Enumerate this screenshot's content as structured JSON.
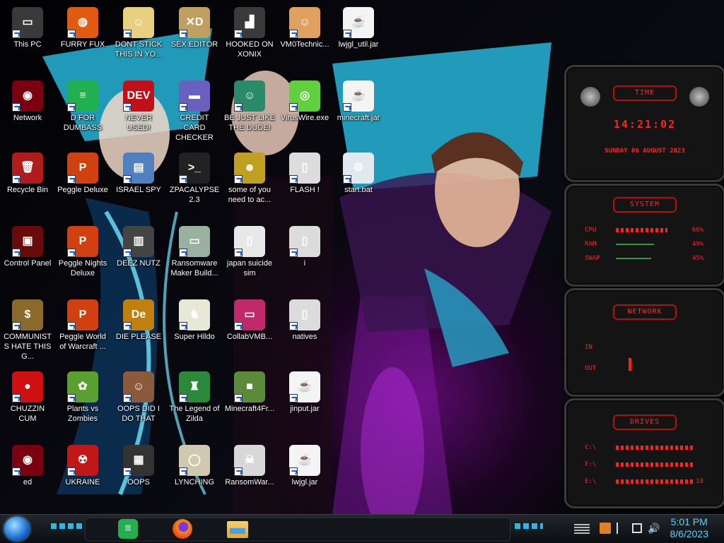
{
  "desktop": {
    "icons": [
      {
        "id": "this-pc",
        "label": "This PC",
        "col": 0,
        "row": 0,
        "color": "#3a3a3a",
        "glyph": "▭"
      },
      {
        "id": "network",
        "label": "Network",
        "col": 0,
        "row": 1,
        "color": "#7a0010",
        "glyph": "◉"
      },
      {
        "id": "recycle-bin",
        "label": "Recycle Bin",
        "col": 0,
        "row": 2,
        "color": "#b01c1c",
        "glyph": "🗑"
      },
      {
        "id": "control-panel",
        "label": "Control Panel",
        "col": 0,
        "row": 3,
        "color": "#6a0a0a",
        "glyph": "▣"
      },
      {
        "id": "communists",
        "label": "COMMUNISTS HATE THIS G...",
        "col": 0,
        "row": 4,
        "color": "#8a6a2a",
        "glyph": "$"
      },
      {
        "id": "chuzzin-cum",
        "label": "CHUZZIN CUM",
        "col": 0,
        "row": 5,
        "color": "#d01010",
        "glyph": "●"
      },
      {
        "id": "bottom-left",
        "label": "ed",
        "col": 0,
        "row": 6,
        "color": "#7a0010",
        "glyph": "◉"
      },
      {
        "id": "furry-fux",
        "label": "FURRY FUX",
        "col": 1,
        "row": 0,
        "color": "#e25a10",
        "glyph": "◍"
      },
      {
        "id": "d-for-dumbass",
        "label": "D FOR DUMBASS",
        "col": 1,
        "row": 1,
        "color": "#20b050",
        "glyph": "≡"
      },
      {
        "id": "peggle-deluxe",
        "label": "Peggle Deluxe",
        "col": 1,
        "row": 2,
        "color": "#d04010",
        "glyph": "P"
      },
      {
        "id": "peggle-nights",
        "label": "Peggle Nights Deluxe",
        "col": 1,
        "row": 3,
        "color": "#d04010",
        "glyph": "P"
      },
      {
        "id": "peggle-world",
        "label": "Peggle World of Warcraft ...",
        "col": 1,
        "row": 4,
        "color": "#d04010",
        "glyph": "P"
      },
      {
        "id": "plants-zombies",
        "label": "Plants vs Zombies",
        "col": 1,
        "row": 5,
        "color": "#5aa030",
        "glyph": "✿"
      },
      {
        "id": "ukraine",
        "label": "UKRAINE",
        "col": 1,
        "row": 6,
        "color": "#c01818",
        "glyph": "☢"
      },
      {
        "id": "dont-stick",
        "label": "DONT STICK THIS IN YO...",
        "col": 2,
        "row": 0,
        "color": "#e8d080",
        "glyph": "☺"
      },
      {
        "id": "never-used",
        "label": "NEVER USED!",
        "col": 2,
        "row": 1,
        "color": "#c0101a",
        "glyph": "DEV"
      },
      {
        "id": "israel-spy",
        "label": "ISRAEL SPY",
        "col": 2,
        "row": 2,
        "color": "#5080c0",
        "glyph": "▤"
      },
      {
        "id": "deez-nutz",
        "label": "DEEZ NUTZ",
        "col": 2,
        "row": 3,
        "color": "#444444",
        "glyph": "▥"
      },
      {
        "id": "die-please",
        "label": "DIE PLEASE",
        "col": 2,
        "row": 4,
        "color": "#c08010",
        "glyph": "De"
      },
      {
        "id": "oops-did-i",
        "label": "OOPS DID I DO THAT",
        "col": 2,
        "row": 5,
        "color": "#8a5a3a",
        "glyph": "☺"
      },
      {
        "id": "oops",
        "label": "OOPS",
        "col": 2,
        "row": 6,
        "color": "#333333",
        "glyph": "▦"
      },
      {
        "id": "sex-editor",
        "label": "SEX EDITOR",
        "col": 3,
        "row": 0,
        "color": "#c0a060",
        "glyph": "✕D"
      },
      {
        "id": "credit-card",
        "label": "CREDIT CARD CHECKER",
        "col": 3,
        "row": 1,
        "color": "#6a60c0",
        "glyph": "▬"
      },
      {
        "id": "zpacalypse",
        "label": "ZPACALYPSE 2.3",
        "col": 3,
        "row": 2,
        "color": "#222222",
        "glyph": ">_"
      },
      {
        "id": "ransomware-maker",
        "label": "Ransomware Maker Build...",
        "col": 3,
        "row": 3,
        "color": "#9ab0a0",
        "glyph": "▭"
      },
      {
        "id": "super-hildo",
        "label": "Super Hildo",
        "col": 3,
        "row": 4,
        "color": "#e8e8d8",
        "glyph": "♞"
      },
      {
        "id": "legend-zilda",
        "label": "The Legend of Zilda",
        "col": 3,
        "row": 5,
        "color": "#2a8a3a",
        "glyph": "♜"
      },
      {
        "id": "lynching",
        "label": "LYNCHING",
        "col": 3,
        "row": 6,
        "color": "#d0c8b0",
        "glyph": "◯"
      },
      {
        "id": "hooked-xonix",
        "label": "HOOKED ON XONIX",
        "col": 4,
        "row": 0,
        "color": "#3a3a3a",
        "glyph": "▟"
      },
      {
        "id": "be-just-like",
        "label": "BE JUST LIKE THE DUDE!",
        "col": 4,
        "row": 1,
        "color": "#2a8a6a",
        "glyph": "☺"
      },
      {
        "id": "some-of-you",
        "label": "some of you need to ac...",
        "col": 4,
        "row": 2,
        "color": "#c0a020",
        "glyph": "☻"
      },
      {
        "id": "japan-suicide",
        "label": "japan suicide sim",
        "col": 4,
        "row": 3,
        "color": "#e8e8e8",
        "glyph": "▯"
      },
      {
        "id": "collabvmb",
        "label": "CollabVMB...",
        "col": 4,
        "row": 4,
        "color": "#c02a6a",
        "glyph": "▭"
      },
      {
        "id": "minecraft4fr",
        "label": "Minecraft4Fr...",
        "col": 4,
        "row": 5,
        "color": "#5a8a3a",
        "glyph": "■"
      },
      {
        "id": "ransomwar",
        "label": "RansomWar...",
        "col": 4,
        "row": 6,
        "color": "#d8d8d8",
        "glyph": "☠"
      },
      {
        "id": "vm0technic",
        "label": "VM0Technic...",
        "col": 5,
        "row": 0,
        "color": "#e0a060",
        "glyph": "☺"
      },
      {
        "id": "viruswire",
        "label": "VirusWire.exe",
        "col": 5,
        "row": 1,
        "color": "#60d040",
        "glyph": "◎"
      },
      {
        "id": "flash",
        "label": "FLASH !",
        "col": 5,
        "row": 2,
        "color": "#dcdcdc",
        "glyph": "▯"
      },
      {
        "id": "i-file",
        "label": "i",
        "col": 5,
        "row": 3,
        "color": "#dcdcdc",
        "glyph": "▯"
      },
      {
        "id": "natives",
        "label": "natives",
        "col": 5,
        "row": 4,
        "color": "#dcdcdc",
        "glyph": "▯"
      },
      {
        "id": "jinput",
        "label": "jinput.jar",
        "col": 5,
        "row": 5,
        "color": "#f4f4f4",
        "glyph": "☕"
      },
      {
        "id": "lwjgl",
        "label": "lwjgl.jar",
        "col": 5,
        "row": 6,
        "color": "#f4f4f4",
        "glyph": "☕"
      },
      {
        "id": "lwjgl-util",
        "label": "lwjgl_util.jar",
        "col": 6,
        "row": 0,
        "color": "#f4f4f4",
        "glyph": "☕"
      },
      {
        "id": "minecraft-jar",
        "label": "minecraft.jar",
        "col": 6,
        "row": 1,
        "color": "#f4f4f4",
        "glyph": "☕"
      },
      {
        "id": "start-bat",
        "label": "start.bat",
        "col": 6,
        "row": 2,
        "color": "#e0e8f0",
        "glyph": "⚙"
      }
    ]
  },
  "widgets": {
    "time": {
      "title": "TIME",
      "clock": "14:21:02",
      "date": "SUNDAY 06 AUGUST 2023"
    },
    "system": {
      "title": "SYSTEM",
      "rows": [
        {
          "label": "CPU",
          "value": "66%",
          "level": 0.66
        },
        {
          "label": "RAM",
          "value": "49%",
          "level": 0.49
        },
        {
          "label": "SWAP",
          "value": "45%",
          "level": 0.45
        }
      ]
    },
    "network": {
      "title": "NETWORK",
      "in_label": "IN",
      "out_label": "OUT"
    },
    "drives": {
      "title": "DRIVES",
      "rows": [
        {
          "label": "C:\\",
          "value": ""
        },
        {
          "label": "F:\\",
          "value": ""
        },
        {
          "label": "E:\\",
          "value": "18"
        }
      ]
    }
  },
  "taskbar": {
    "time": "5:01 PM",
    "date": "8/6/2023",
    "pinned": [
      {
        "name": "notes-app-icon",
        "color": "#20b050"
      },
      {
        "name": "firefox-icon",
        "color": "#e25a10"
      },
      {
        "name": "file-explorer-icon",
        "color": "#e8b040"
      }
    ]
  },
  "colors": {
    "accent_red": "#ff2020",
    "taskbar_blue": "#5ad2ff"
  }
}
